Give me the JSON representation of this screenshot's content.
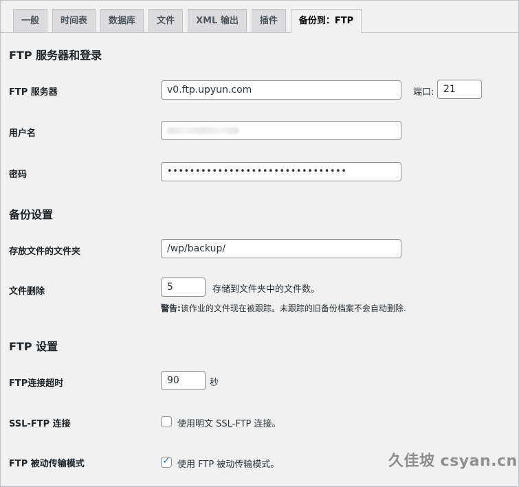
{
  "tabs": [
    {
      "label": "一般"
    },
    {
      "label": "时间表"
    },
    {
      "label": "数据库"
    },
    {
      "label": "文件"
    },
    {
      "label": "XML 输出"
    },
    {
      "label": "插件"
    },
    {
      "label": "备份到：FTP",
      "active": true
    }
  ],
  "sections": {
    "ftp_server_login": "FTP 服务器和登录",
    "backup_settings": "备份设置",
    "ftp_settings": "FTP 设置"
  },
  "fields": {
    "ftp_server": {
      "label": "FTP 服务器",
      "value": "v0.ftp.upyun.com"
    },
    "port": {
      "label": "端口:",
      "value": "21"
    },
    "username": {
      "label": "用户名",
      "value": ""
    },
    "password": {
      "label": "密码",
      "value": "••••••••••••••••••••••••••••••••"
    },
    "folder": {
      "label": "存放文件的文件夹",
      "value": "/wp/backup/"
    },
    "file_delete": {
      "label": "文件删除",
      "value": "5",
      "suffix": "存储到文件夹中的文件数。",
      "warning_bold": "警告:",
      "warning_text": "该作业的文件现在被跟踪。未跟踪的旧备份档案不会自动删除."
    },
    "timeout": {
      "label": "FTP连接超时",
      "value": "90",
      "suffix": "秒"
    },
    "ssl": {
      "label": "SSL-FTP 连接",
      "checkbox_label": "使用明文 SSL-FTP 连接。",
      "checked": false
    },
    "passive": {
      "label": "FTP 被动传输模式",
      "checkbox_label": "使用 FTP 被动传输模式。",
      "checked": true
    }
  },
  "watermark": "久佳坡 csyan.cn",
  "colors": {
    "accent": "#2271b1",
    "tab_bg": "#dcdcde",
    "page_bg": "#f1f1f1"
  }
}
